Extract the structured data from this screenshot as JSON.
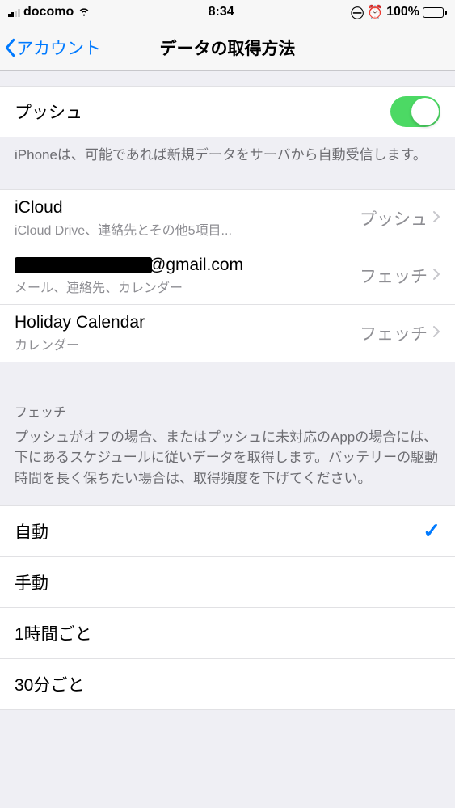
{
  "statusBar": {
    "carrier": "docomo",
    "time": "8:34",
    "battery": "100%"
  },
  "nav": {
    "back": "アカウント",
    "title": "データの取得方法"
  },
  "push": {
    "label": "プッシュ",
    "footer": "iPhoneは、可能であれば新規データをサーバから自動受信します。"
  },
  "accounts": [
    {
      "title": "iCloud",
      "sub": "iCloud Drive、連絡先とその他5項目...",
      "value": "プッシュ"
    },
    {
      "title": "@gmail.com",
      "sub": "メール、連絡先、カレンダー",
      "value": "フェッチ",
      "redacted": true
    },
    {
      "title": "Holiday Calendar",
      "sub": "カレンダー",
      "value": "フェッチ"
    }
  ],
  "fetch": {
    "header": "フェッチ",
    "desc": "プッシュがオフの場合、またはプッシュに未対応のAppの場合には、下にあるスケジュールに従いデータを取得します。バッテリーの駆動時間を長く保ちたい場合は、取得頻度を下げてください。",
    "options": [
      {
        "label": "自動",
        "selected": true
      },
      {
        "label": "手動",
        "selected": false
      },
      {
        "label": "1時間ごと",
        "selected": false
      },
      {
        "label": "30分ごと",
        "selected": false
      }
    ]
  }
}
